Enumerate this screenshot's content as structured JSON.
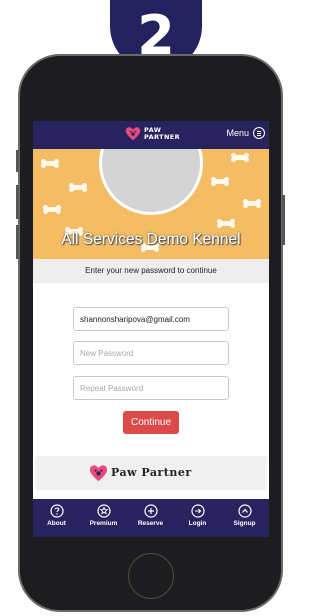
{
  "step_badge": {
    "number": "2"
  },
  "header": {
    "logo_line1": "PAW",
    "logo_line2": "PARTNER",
    "menu_label": "Menu"
  },
  "hero": {
    "kennel_name": "All Services Demo Kennel"
  },
  "instruction": "Enter your new password to continue",
  "form": {
    "email_value": "shannonsharipova@gmail.com",
    "new_password_placeholder": "New Password",
    "repeat_password_placeholder": "Repeat Password",
    "continue_label": "Continue"
  },
  "brand": {
    "name": "Paw Partner"
  },
  "tabbar": {
    "items": [
      {
        "label": "About",
        "icon": "question-icon"
      },
      {
        "label": "Premium",
        "icon": "star-icon"
      },
      {
        "label": "Reserve",
        "icon": "plus-icon"
      },
      {
        "label": "Login",
        "icon": "login-icon"
      },
      {
        "label": "Signup",
        "icon": "chevron-up-icon"
      }
    ]
  },
  "colors": {
    "navy": "#28235f",
    "hero_orange": "#f5bd63",
    "continue_red": "#dc4a4a",
    "logo_pink": "#e84a7a"
  }
}
